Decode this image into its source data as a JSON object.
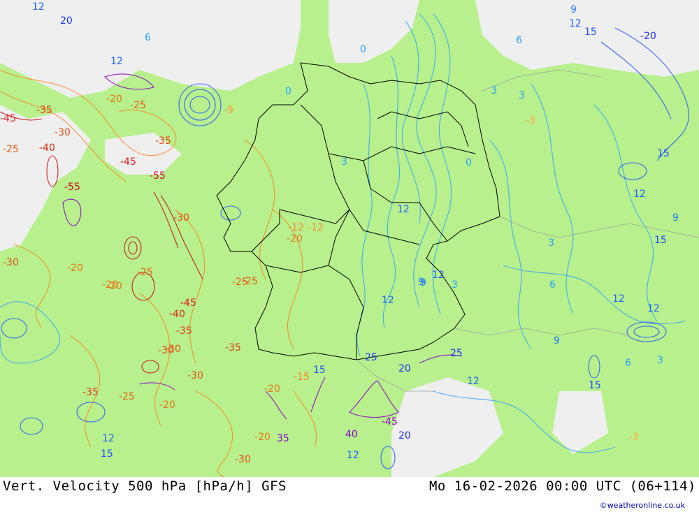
{
  "map": {
    "title": "Vert. Velocity 500 hPa [hPa/h] GFS",
    "valid_time": "Mo 16-02-2026 00:00 UTC (06+114)",
    "credit": "©weatheronline.co.uk",
    "colors": {
      "background": "#b7f08c",
      "no_data": "#efefef",
      "border": "#000000",
      "positive_contours": "#0050ff",
      "negative_contours": "#ff3c00",
      "strong_positive": "#8c00c8",
      "strong_negative": "#c80000"
    },
    "contour_labels": [
      {
        "text": "12",
        "c": "#1e64ff"
      },
      {
        "text": "20",
        "c": "#1e32ff"
      },
      {
        "text": "6",
        "c": "#28a0ff"
      },
      {
        "text": "0",
        "c": "#28a0ff"
      },
      {
        "text": "9",
        "c": "#1e78ff"
      },
      {
        "text": "12",
        "c": "#1e64ff"
      },
      {
        "text": "15",
        "c": "#1e50ff"
      },
      {
        "text": "-20",
        "c": "#1e32ff"
      },
      {
        "text": "6",
        "c": "#28a0ff"
      },
      {
        "text": "3",
        "c": "#28a0ff"
      },
      {
        "text": "3",
        "c": "#28a0ff"
      },
      {
        "text": "0",
        "c": "#28a0ff"
      },
      {
        "text": "-45",
        "c": "#dc1e1e"
      },
      {
        "text": "-35",
        "c": "#e63c14"
      },
      {
        "text": "-30",
        "c": "#e65014"
      },
      {
        "text": "-40",
        "c": "#dc2814"
      },
      {
        "text": "-25",
        "c": "#e66414"
      },
      {
        "text": "-45",
        "c": "#dc1e1e"
      },
      {
        "text": "-55",
        "c": "#c80a1e"
      },
      {
        "text": "-55",
        "c": "#c80a1e"
      },
      {
        "text": "-35",
        "c": "#e63c14"
      },
      {
        "text": "-20",
        "c": "#e67814"
      },
      {
        "text": "-25",
        "c": "#e66414"
      },
      {
        "text": "-9",
        "c": "#ff9632"
      },
      {
        "text": "-30",
        "c": "#e65014"
      },
      {
        "text": "-12",
        "c": "#ff8c28"
      },
      {
        "text": "-20",
        "c": "#e67814"
      },
      {
        "text": "-25",
        "c": "#e66414"
      },
      {
        "text": "-45",
        "c": "#dc1e1e"
      },
      {
        "text": "-40",
        "c": "#dc2814"
      },
      {
        "text": "-35",
        "c": "#e63c14"
      },
      {
        "text": "-30",
        "c": "#e65014"
      },
      {
        "text": "-35",
        "c": "#e63c14"
      },
      {
        "text": "-30",
        "c": "#e65014"
      },
      {
        "text": "-20",
        "c": "#e67814"
      },
      {
        "text": "-30",
        "c": "#e65014"
      },
      {
        "text": "-25",
        "c": "#e66414"
      },
      {
        "text": "-35",
        "c": "#e63c14"
      },
      {
        "text": "-20",
        "c": "#e67814"
      },
      {
        "text": "-25",
        "c": "#e66414"
      },
      {
        "text": "-20",
        "c": "#e67814"
      },
      {
        "text": "-15",
        "c": "#ff8228"
      },
      {
        "text": "-30",
        "c": "#e65014"
      },
      {
        "text": "-20",
        "c": "#e67814"
      },
      {
        "text": "35",
        "c": "#8c00c8"
      },
      {
        "text": "25",
        "c": "#1e32ff"
      },
      {
        "text": "20",
        "c": "#1e32ff"
      },
      {
        "text": "25",
        "c": "#1e32ff"
      },
      {
        "text": "15",
        "c": "#1e50ff"
      },
      {
        "text": "-45",
        "c": "#8c00c8"
      },
      {
        "text": "40",
        "c": "#8c00c8"
      },
      {
        "text": "20",
        "c": "#1e32ff"
      },
      {
        "text": "12",
        "c": "#1e64ff"
      },
      {
        "text": "12",
        "c": "#1e64ff"
      },
      {
        "text": "12",
        "c": "#1e64ff"
      },
      {
        "text": "9",
        "c": "#1e78ff"
      },
      {
        "text": "3",
        "c": "#28a0ff"
      },
      {
        "text": "12",
        "c": "#1e64ff"
      },
      {
        "text": "12",
        "c": "#1e64ff"
      },
      {
        "text": "15",
        "c": "#1e50ff"
      },
      {
        "text": "12",
        "c": "#1e64ff"
      },
      {
        "text": "15",
        "c": "#1e50ff"
      },
      {
        "text": "9",
        "c": "#1e78ff"
      },
      {
        "text": "3",
        "c": "#28a0ff"
      },
      {
        "text": "6",
        "c": "#28a0ff"
      },
      {
        "text": "12",
        "c": "#1e64ff"
      },
      {
        "text": "15",
        "c": "#1e50ff"
      },
      {
        "text": "12",
        "c": "#1e64ff"
      },
      {
        "text": "3",
        "c": "#28a0ff"
      },
      {
        "text": "6",
        "c": "#28a0ff"
      },
      {
        "text": "9",
        "c": "#1e78ff"
      },
      {
        "text": "-3",
        "c": "#ffaa3c"
      },
      {
        "text": "15",
        "c": "#1e50ff"
      },
      {
        "text": "12",
        "c": "#1e64ff"
      },
      {
        "text": "-3",
        "c": "#ffaa3c"
      },
      {
        "text": "0",
        "c": "#28a0ff"
      },
      {
        "text": "3",
        "c": "#28a0ff"
      },
      {
        "text": "12",
        "c": "#1e64ff"
      },
      {
        "text": "-12",
        "c": "#ff8c28"
      },
      {
        "text": "-20",
        "c": "#e67814"
      },
      {
        "text": "-25",
        "c": "#e66414"
      },
      {
        "text": "9",
        "c": "#1e78ff"
      },
      {
        "text": "-30",
        "c": "#e65014"
      },
      {
        "text": "-20",
        "c": "#e67814"
      }
    ]
  }
}
